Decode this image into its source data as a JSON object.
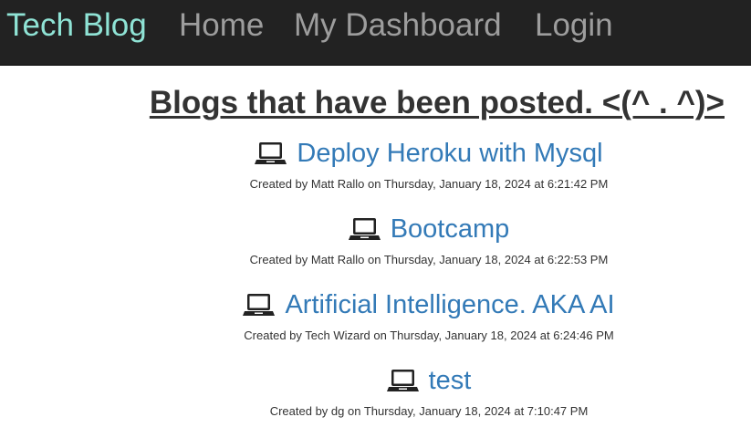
{
  "nav": {
    "brand": "Tech Blog",
    "home": "Home",
    "dashboard": "My Dashboard",
    "login": "Login"
  },
  "main": {
    "heading": "Blogs that have been posted. <(^ . ^)>"
  },
  "posts": [
    {
      "icon": "laptop-icon",
      "title": "Deploy Heroku with Mysql",
      "meta": "Created by Matt Rallo on Thursday, January 18, 2024 at 6:21:42 PM"
    },
    {
      "icon": "laptop-icon",
      "title": "Bootcamp",
      "meta": "Created by Matt Rallo on Thursday, January 18, 2024 at 6:22:53 PM"
    },
    {
      "icon": "laptop-icon",
      "title": "Artificial Intelligence. AKA AI",
      "meta": "Created by Tech Wizard on Thursday, January 18, 2024 at 6:24:46 PM"
    },
    {
      "icon": "laptop-icon",
      "title": "test",
      "meta": "Created by dg on Thursday, January 18, 2024 at 7:10:47 PM"
    }
  ],
  "colors": {
    "navbar_bg": "#222222",
    "brand": "#8fe3d5",
    "nav_link": "#9d9d9d",
    "post_link": "#337ab7",
    "text": "#333333"
  }
}
